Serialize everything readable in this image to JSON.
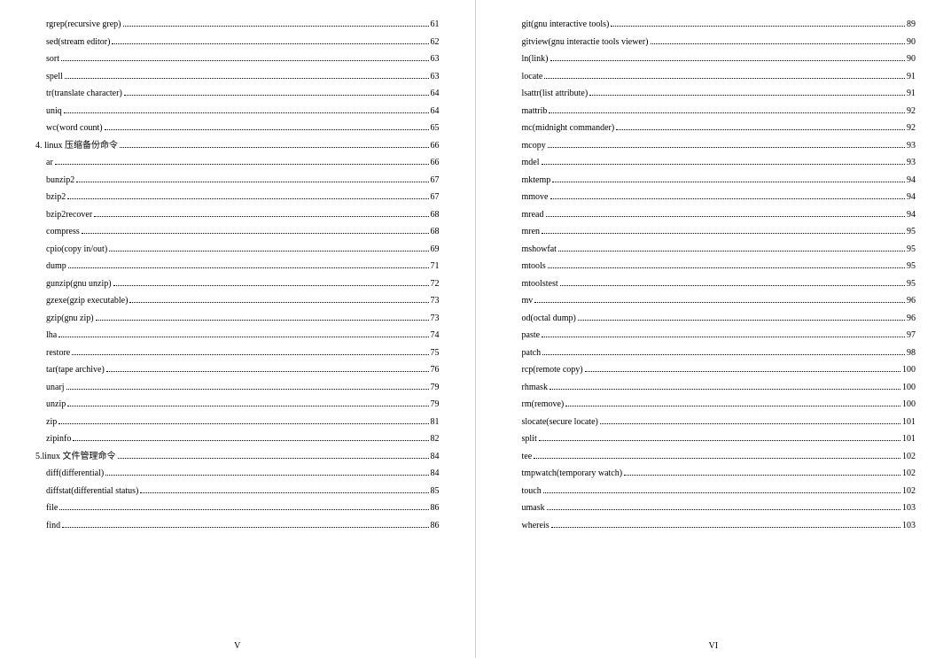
{
  "leftPage": {
    "entries": [
      {
        "level": 2,
        "label": "rgrep(recursive grep)",
        "page": "61"
      },
      {
        "level": 2,
        "label": "sed(stream editor)",
        "page": "62"
      },
      {
        "level": 2,
        "label": "sort",
        "page": "63"
      },
      {
        "level": 2,
        "label": "spell",
        "page": "63"
      },
      {
        "level": 2,
        "label": "tr(translate character)",
        "page": "64"
      },
      {
        "level": 2,
        "label": "uniq",
        "page": "64"
      },
      {
        "level": 2,
        "label": "wc(word count)",
        "page": "65"
      },
      {
        "level": 1,
        "label": "4. linux 压缩备份命令",
        "page": "66"
      },
      {
        "level": 2,
        "label": "ar",
        "page": "66"
      },
      {
        "level": 2,
        "label": "bunzip2",
        "page": "67"
      },
      {
        "level": 2,
        "label": "bzip2",
        "page": "67"
      },
      {
        "level": 2,
        "label": "bzip2recover",
        "page": "68"
      },
      {
        "level": 2,
        "label": "compress",
        "page": "68"
      },
      {
        "level": 2,
        "label": "cpio(copy in/out)",
        "page": "69"
      },
      {
        "level": 2,
        "label": "dump",
        "page": "71"
      },
      {
        "level": 2,
        "label": "gunzip(gnu unzip)",
        "page": "72"
      },
      {
        "level": 2,
        "label": "gzexe(gzip executable)",
        "page": "73"
      },
      {
        "level": 2,
        "label": "gzip(gnu zip)",
        "page": "73"
      },
      {
        "level": 2,
        "label": "lha",
        "page": "74"
      },
      {
        "level": 2,
        "label": "restore",
        "page": "75"
      },
      {
        "level": 2,
        "label": "tar(tape archive)",
        "page": "76"
      },
      {
        "level": 2,
        "label": "unarj",
        "page": "79"
      },
      {
        "level": 2,
        "label": "unzip",
        "page": "79"
      },
      {
        "level": 2,
        "label": "zip",
        "page": "81"
      },
      {
        "level": 2,
        "label": "zipinfo",
        "page": "82"
      },
      {
        "level": 1,
        "label": "5.linux 文件管理命令",
        "page": "84"
      },
      {
        "level": 2,
        "label": "diff(differential)",
        "page": "84"
      },
      {
        "level": 2,
        "label": "diffstat(differential status)",
        "page": "85"
      },
      {
        "level": 2,
        "label": "file",
        "page": "86"
      },
      {
        "level": 2,
        "label": "find",
        "page": "86"
      }
    ],
    "pageNumber": "V"
  },
  "rightPage": {
    "entries": [
      {
        "level": 2,
        "label": "git(gnu interactive tools)",
        "page": "89"
      },
      {
        "level": 2,
        "label": "gitview(gnu interactie tools viewer)",
        "page": "90"
      },
      {
        "level": 2,
        "label": "ln(link)",
        "page": "90"
      },
      {
        "level": 2,
        "label": "locate",
        "page": "91"
      },
      {
        "level": 2,
        "label": "lsattr(list attribute)",
        "page": "91"
      },
      {
        "level": 2,
        "label": "mattrib",
        "page": "92"
      },
      {
        "level": 2,
        "label": "mc(midnight commander)",
        "page": "92"
      },
      {
        "level": 2,
        "label": "mcopy",
        "page": "93"
      },
      {
        "level": 2,
        "label": "mdel",
        "page": "93"
      },
      {
        "level": 2,
        "label": "mktemp",
        "page": "94"
      },
      {
        "level": 2,
        "label": "mmove",
        "page": "94"
      },
      {
        "level": 2,
        "label": "mread",
        "page": "94"
      },
      {
        "level": 2,
        "label": "mren",
        "page": "95"
      },
      {
        "level": 2,
        "label": "mshowfat",
        "page": "95"
      },
      {
        "level": 2,
        "label": "mtools",
        "page": "95"
      },
      {
        "level": 2,
        "label": "mtoolstest",
        "page": "95"
      },
      {
        "level": 2,
        "label": "mv",
        "page": "96"
      },
      {
        "level": 2,
        "label": "od(octal dump)",
        "page": "96"
      },
      {
        "level": 2,
        "label": "paste",
        "page": "97"
      },
      {
        "level": 2,
        "label": "patch",
        "page": "98"
      },
      {
        "level": 2,
        "label": "rcp(remote copy)",
        "page": "100"
      },
      {
        "level": 2,
        "label": "rhmask",
        "page": "100"
      },
      {
        "level": 2,
        "label": "rm(remove)",
        "page": "100"
      },
      {
        "level": 2,
        "label": "slocate(secure locate)",
        "page": "101"
      },
      {
        "level": 2,
        "label": "split",
        "page": "101"
      },
      {
        "level": 2,
        "label": "tee",
        "page": "102"
      },
      {
        "level": 2,
        "label": "tmpwatch(temporary watch)",
        "page": "102"
      },
      {
        "level": 2,
        "label": "touch",
        "page": "102"
      },
      {
        "level": 2,
        "label": "umask",
        "page": "103"
      },
      {
        "level": 2,
        "label": "whereis",
        "page": "103"
      }
    ],
    "pageNumber": "VI"
  }
}
